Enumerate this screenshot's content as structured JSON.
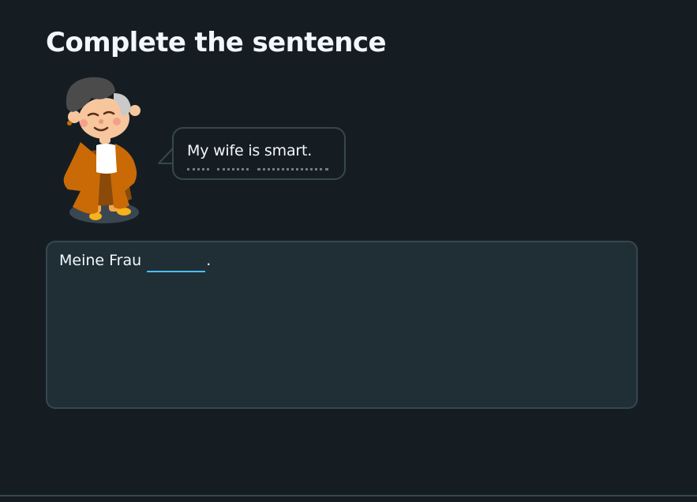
{
  "exercise": {
    "title": "Complete the sentence"
  },
  "prompt": {
    "speaker_icon": "character-illustration-icon",
    "text": "My wife is smart."
  },
  "answer": {
    "prefix": "Meine Frau",
    "blank_value": "",
    "suffix": "."
  },
  "colors": {
    "background": "#151d23",
    "panel": "#202f36",
    "border": "#37464f",
    "blank_underline": "#49c0f8",
    "text": "#f1f7fb"
  }
}
